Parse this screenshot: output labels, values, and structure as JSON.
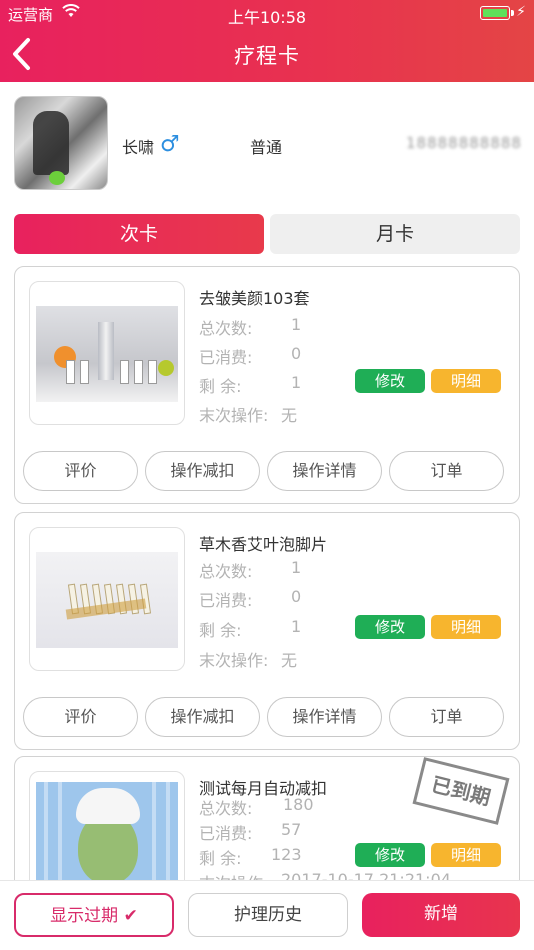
{
  "status_bar": {
    "carrier": "运营商",
    "time": "上午10:58"
  },
  "nav": {
    "title": "疗程卡",
    "back_icon": "chevron-left-icon"
  },
  "profile": {
    "name": "长啸",
    "gender_symbol": "♂",
    "level": "普通",
    "phone": "18888888888"
  },
  "tabs": [
    {
      "label": "次卡",
      "active": true
    },
    {
      "label": "月卡",
      "active": false
    }
  ],
  "labels": {
    "total": "总次数:",
    "consumed": "已消费:",
    "remaining": "剩    余:",
    "last_op": "末次操作:",
    "modify": "修改",
    "detail": "明细",
    "expired_stamp": "已到期"
  },
  "cards": [
    {
      "title": "去皱美颜103套",
      "total": "1",
      "consumed": "0",
      "remaining": "1",
      "last_op": "无",
      "expired": false
    },
    {
      "title": "草木香艾叶泡脚片",
      "total": "1",
      "consumed": "0",
      "remaining": "1",
      "last_op": "无",
      "expired": false
    },
    {
      "title": "测试每月自动减扣",
      "total": "180",
      "consumed": "57",
      "remaining": "123",
      "last_op": "2017-10-17 21:21:04",
      "expired": true
    }
  ],
  "card_actions": [
    "评价",
    "操作减扣",
    "操作详情",
    "订单"
  ],
  "bottom": {
    "show_expired": "显示过期 ✔",
    "history": "护理历史",
    "add": "新增"
  },
  "colors": {
    "primary": "#e8215e",
    "modify_green": "#1fae56",
    "detail_orange": "#f7b52e",
    "gender_blue": "#2d8fe0"
  }
}
